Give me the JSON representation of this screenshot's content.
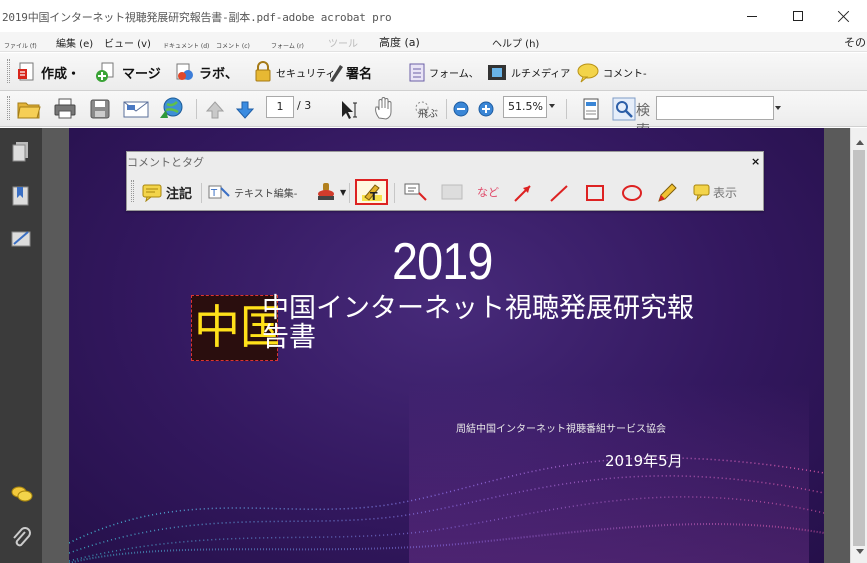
{
  "window": {
    "title": "2019中国インターネット視聴発展研究報告書-副本.pdf-adobe acrobat pro"
  },
  "menu": {
    "items": [
      {
        "label": "ファイル (f)",
        "size": "small"
      },
      {
        "label": "編集 (e)",
        "size": "big"
      },
      {
        "label": "ビュー (v)",
        "size": "big"
      },
      {
        "label": "ドキュメント (d)",
        "size": "small"
      },
      {
        "label": "コメント (c)",
        "size": "small"
      },
      {
        "label": "フォーム (r)",
        "size": "small"
      },
      {
        "label": "ツール",
        "size": "faded"
      },
      {
        "label": "高度 (a)",
        "size": "big"
      },
      {
        "label": "ヘルプ (h)",
        "size": "big"
      },
      {
        "label": "その",
        "size": "big"
      }
    ]
  },
  "toolbar1": {
    "create": "作成・",
    "merge": "マージ",
    "collab": "ラボ、",
    "security": "セキュリティ",
    "sign": "署名",
    "forms": "フォーム、",
    "multimedia": "ルチメディア",
    "comment": "コメント-"
  },
  "toolbar2": {
    "page_current": "1",
    "page_total": "/ 3",
    "zoom": "51.5%",
    "search_label": "検索",
    "hand_label": "飛ぶ"
  },
  "comment_bar": {
    "title": "コメントとタグ",
    "close": "×",
    "note": "注記",
    "text_edit": "テキスト編集-",
    "etc": "など",
    "show": "表示"
  },
  "slide": {
    "year": "2019",
    "title": "中国インターネット視聴発展研究報告書",
    "highlight": "中国",
    "org": "周結中国インターネット視聴番組サービス協会",
    "date": "2019年5月"
  },
  "colors": {
    "slide_bg": "#33185f",
    "highlight_text": "#ffe11a",
    "selection_border": "#d22222"
  }
}
